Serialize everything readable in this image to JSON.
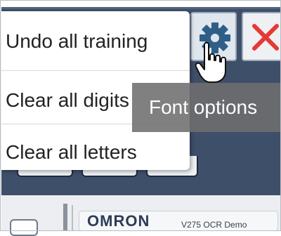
{
  "menu": {
    "items": [
      {
        "label": "Undo all training"
      },
      {
        "label": "Clear all digits"
      },
      {
        "label": "Clear all letters"
      }
    ]
  },
  "toolbar": {
    "settings_icon": "gear-icon",
    "close_icon": "close-icon"
  },
  "tooltip": {
    "text": "Font options"
  },
  "device": {
    "brand": "OMRON",
    "model": "V275 OCR Demo"
  },
  "colors": {
    "toolbar": "#3e4f69",
    "gear": "#2f5f86",
    "close": "#e53935",
    "tooltip": "#6e6e6e"
  }
}
